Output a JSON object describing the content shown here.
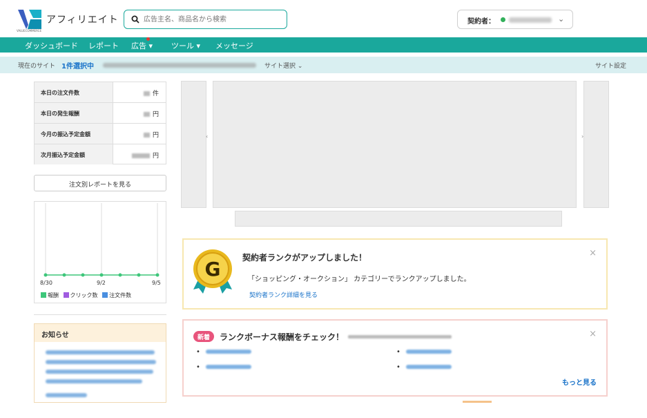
{
  "header": {
    "logo_text": "アフィリエイト",
    "logo_sub": "VALUECOMMERCE",
    "search_placeholder": "広告主名、商品名から検索",
    "contract_label": "契約者："
  },
  "nav": {
    "items": [
      "ダッシュボード",
      "レポート",
      "広告",
      "ツール",
      "メッセージ"
    ],
    "accent_color": "#1aa89c"
  },
  "sitebar": {
    "current_label": "現在のサイト",
    "selected_label": "1件選択中",
    "pick_label": "サイト選択",
    "settings_label": "サイト設定"
  },
  "stats": {
    "rows": [
      {
        "label": "本日の注文件数",
        "unit": "件"
      },
      {
        "label": "本日の発生報酬",
        "unit": "円"
      },
      {
        "label": "今月の振込予定金額",
        "unit": "円"
      },
      {
        "label": "次月振込予定金額",
        "unit": "円"
      }
    ]
  },
  "report_button": "注文別レポートを見る",
  "chart": {
    "x_ticks": [
      "8/30",
      "9/2",
      "9/5"
    ],
    "legend": [
      {
        "label": "報酬",
        "color": "#3ec67a"
      },
      {
        "label": "クリック数",
        "color": "#a05ce0"
      },
      {
        "label": "注文件数",
        "color": "#4a8fe0"
      }
    ]
  },
  "notice": {
    "title": "お知らせ"
  },
  "rank_card": {
    "medal_letter": "G",
    "title": "契約者ランクがアップしました！",
    "description": "「ショッピング・オークション」 カテゴリーでランクアップしました。",
    "link": "契約者ランク詳細を見る",
    "close": "×"
  },
  "bonus_card": {
    "badge": "新着",
    "title": "ランクボーナス報酬をチェック！",
    "bullet": "•",
    "more": "もっと見る",
    "close": "×"
  }
}
